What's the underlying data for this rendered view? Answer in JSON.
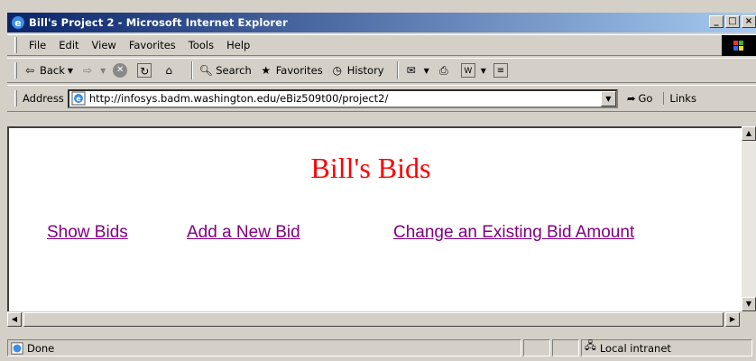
{
  "window": {
    "title": "Bill's Project 2 - Microsoft Internet Explorer",
    "buttons": {
      "minimize": "_",
      "maximize": "□",
      "close": "×"
    }
  },
  "menu": [
    "File",
    "Edit",
    "View",
    "Favorites",
    "Tools",
    "Help"
  ],
  "toolbar": {
    "back": "Back",
    "search": "Search",
    "favorites": "Favorites",
    "history": "History"
  },
  "address": {
    "label": "Address",
    "url": "http://infosys.badm.washington.edu/eBiz509t00/project2/",
    "go": "Go",
    "links": "Links"
  },
  "page": {
    "heading": "Bill's Bids",
    "links": [
      "Show Bids",
      "Add a New Bid",
      "Change an Existing Bid Amount"
    ],
    "heading_color": "#ff0000",
    "link_color": "#800080"
  },
  "status": {
    "text": "Done",
    "zone": "Local intranet"
  }
}
